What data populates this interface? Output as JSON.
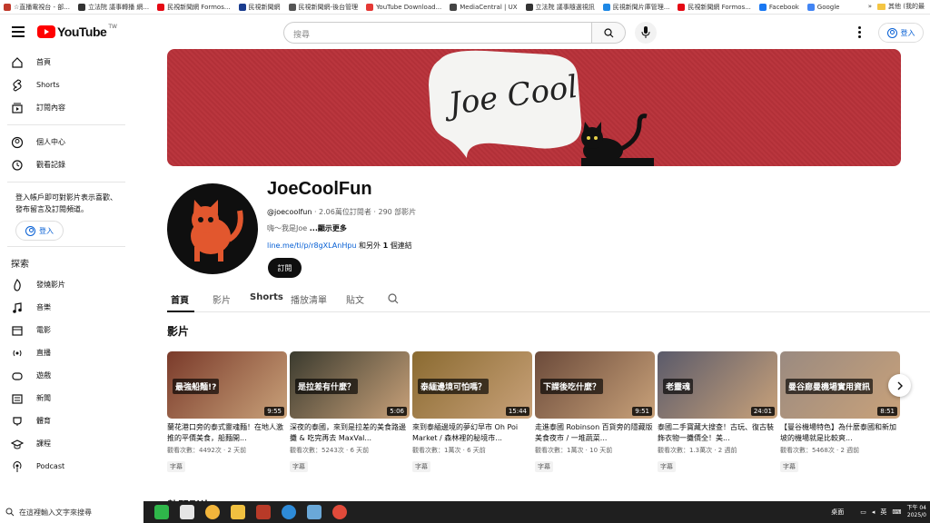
{
  "bookmarks": [
    {
      "label": "☆直播電視台 - 部...",
      "color": "#c0392b"
    },
    {
      "label": "立法院 議事轉播 網...",
      "color": "#333333"
    },
    {
      "label": "民視新聞網 Formos...",
      "color": "#e50914"
    },
    {
      "label": "民視新聞網",
      "color": "#1a3c8f"
    },
    {
      "label": "民視新聞網-後台管理",
      "color": "#555555"
    },
    {
      "label": "YouTube Download...",
      "color": "#e53935"
    },
    {
      "label": "MediaCentral | UX",
      "color": "#444444"
    },
    {
      "label": "立法院 議事隨選視訊",
      "color": "#333333"
    },
    {
      "label": "民視新聞片庫管理...",
      "color": "#1e88e5"
    },
    {
      "label": "民視新聞網 Formos...",
      "color": "#e50914"
    },
    {
      "label": "Facebook",
      "color": "#1877f2"
    },
    {
      "label": "Google",
      "color": "#4285f4"
    }
  ],
  "bookmarks_other": "其他 (我的最",
  "masthead": {
    "logo_text": "YouTube",
    "region": "TW",
    "search_placeholder": "搜尋",
    "signin": "登入"
  },
  "sidebar": {
    "main": [
      {
        "label": "首頁",
        "icon": "home-icon"
      },
      {
        "label": "Shorts",
        "icon": "shorts-icon"
      },
      {
        "label": "訂閱內容",
        "icon": "subscriptions-icon"
      }
    ],
    "you": [
      {
        "label": "個人中心",
        "icon": "you-icon"
      },
      {
        "label": "觀看記錄",
        "icon": "history-icon"
      }
    ],
    "signin_note": "登入帳戶即可對影片表示喜歡、發布留言及訂閱頻道。",
    "signin_button": "登入",
    "explore_title": "探索",
    "explore": [
      {
        "label": "發燒影片",
        "icon": "trending-icon"
      },
      {
        "label": "音樂",
        "icon": "music-icon"
      },
      {
        "label": "電影",
        "icon": "movies-icon"
      },
      {
        "label": "直播",
        "icon": "live-icon"
      },
      {
        "label": "遊戲",
        "icon": "gaming-icon"
      },
      {
        "label": "新聞",
        "icon": "news-icon"
      },
      {
        "label": "體育",
        "icon": "sports-icon"
      },
      {
        "label": "課程",
        "icon": "courses-icon"
      },
      {
        "label": "Podcast",
        "icon": "podcast-icon"
      }
    ]
  },
  "banner": {
    "text": "Joe Cool"
  },
  "channel": {
    "name": "JoeCoolFun",
    "handle": "@joecoolfun",
    "stats": "· 2.06萬位訂閱者 · 290 部影片",
    "description": "嗨～我是Joe",
    "more": "...顯示更多",
    "link": "line.me/ti/p/r8gXLAnHpu",
    "link_suffix": " 和另外 ",
    "link_count": "1",
    "link_suffix2": " 個連結",
    "subscribe": "訂閱"
  },
  "tabs": [
    "首頁",
    "影片",
    "Shorts",
    "播放清單",
    "貼文"
  ],
  "section_title": "影片",
  "videos": [
    {
      "title": "蘭花港口旁的泰式靈魂麵！在地人激推的平價美食，船麵開...",
      "views": "觀看次數：4492次 · 2 天前",
      "duration": "9:55",
      "caption": "最強船麵!?",
      "badge": "字幕",
      "bg": "#7a3a2a"
    },
    {
      "title": "深夜的泰國，來到是拉差的美食路邊攤 & 吃完再去 MaxVal...",
      "views": "觀看次數：5243次 · 6 天前",
      "duration": "5:06",
      "caption": "是拉差有什麼？",
      "badge": "字幕",
      "bg": "#3a3a2e"
    },
    {
      "title": "來到泰緬邊境的夢幻早市 Oh Poi Market / 森林裡的秘境市...",
      "views": "觀看次數：1萬次 · 6 天前",
      "duration": "15:44",
      "caption": "泰緬邊境可怕嗎？",
      "badge": "字幕",
      "bg": "#8a6a30"
    },
    {
      "title": "走進泰國 Robinson 百貨旁的隱藏版美食夜市 / 一堆蔬菜...",
      "views": "觀看次數：1萬次 · 10 天前",
      "duration": "9:51",
      "caption": "下課後吃什麼？",
      "badge": "字幕",
      "bg": "#6b4a3a"
    },
    {
      "title": "泰國二手寶藏大搜查！古玩、復古裝飾衣物一攤價全！美...",
      "views": "觀看次數：1.3萬次 · 2 週前",
      "duration": "24:01",
      "caption": "老靈魂",
      "badge": "字幕",
      "bg": "#5a5a6a"
    },
    {
      "title": "【曼谷機場特色】為什麼泰國和新加坡的機場就是比較爽...",
      "views": "觀看次數：5468次 · 2 週前",
      "duration": "8:51",
      "caption": "曼谷廊曼機場實用資訊",
      "badge": "字幕",
      "bg": "#9a8a80"
    }
  ],
  "section2_title": "熱門影片",
  "taskbar": {
    "search_placeholder": "在這裡輸入文字來搜尋",
    "tray_label": "桌面",
    "ime": "英",
    "clock_top": "下午 04",
    "clock_bottom": "2025/0"
  }
}
